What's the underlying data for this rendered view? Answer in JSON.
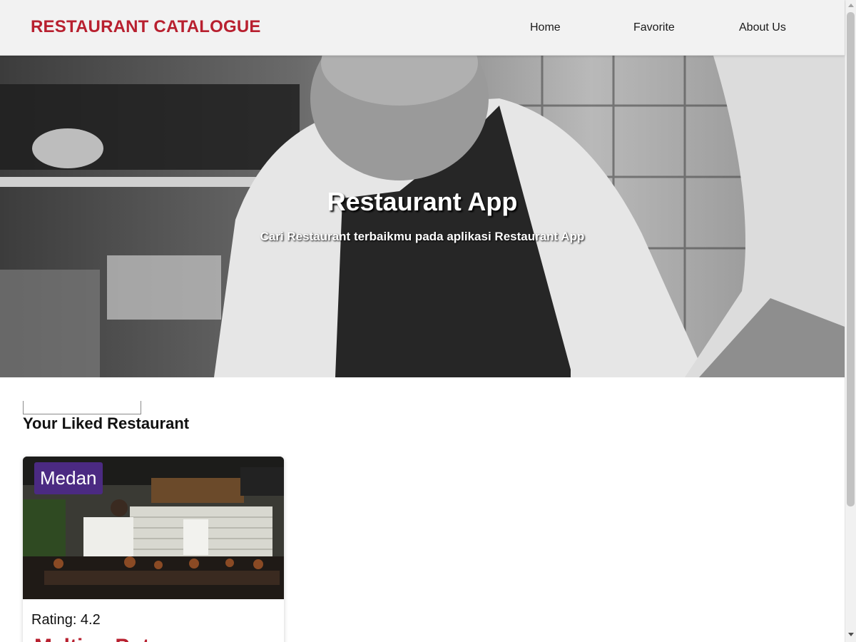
{
  "header": {
    "brand": "RESTAURANT CATALOGUE",
    "nav": [
      "Home",
      "Favorite",
      "About Us"
    ]
  },
  "hero": {
    "title": "Restaurant App",
    "subtitle": "Cari Restaurant terbaikmu pada aplikasi Restaurant App"
  },
  "search": {
    "placeholder": ""
  },
  "main": {
    "section_title": "Your Liked Restaurant",
    "restaurants": [
      {
        "city": "Medan",
        "rating_label": "Rating: 4.2",
        "name": "Melting Pot"
      }
    ]
  },
  "colors": {
    "brand": "#b8202f",
    "badge": "#4b2a82",
    "navbar": "#f2f2f2"
  },
  "icons": [
    "hero-chef-image",
    "restaurant-kitchen-image",
    "scroll-up-arrow-icon",
    "scroll-down-arrow-icon"
  ]
}
